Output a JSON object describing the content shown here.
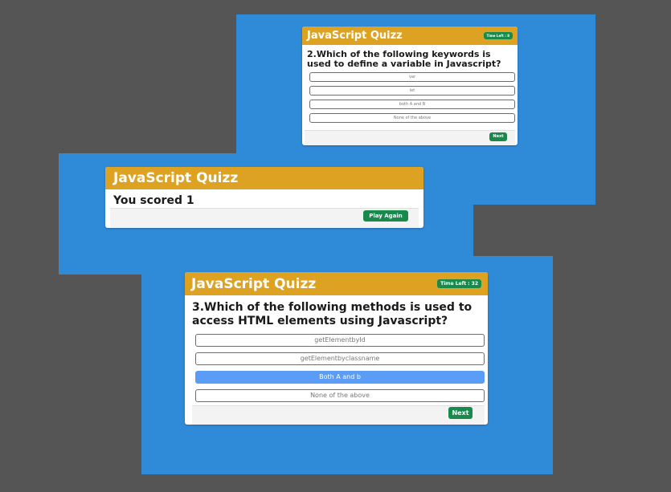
{
  "quiz_title": "JavaScript Quizz",
  "screen1": {
    "timer": "Time Left : 8",
    "question": "2.Which of the following keywords is used to define a variable in Javascript?",
    "options": [
      "var",
      "let",
      "both A and B",
      "None of the above"
    ],
    "next_label": "Next"
  },
  "screen2": {
    "result": "You scored 1",
    "play_again_label": "Play Again"
  },
  "screen3": {
    "timer": "Time Left : 32",
    "question": "3.Which of the following methods is used to access HTML elements using Javascript?",
    "options": [
      "getElementbyId",
      "getElementbyclassname",
      "Both A and b",
      "None of the above"
    ],
    "selected_option": "Both A and b",
    "next_label": "Next"
  },
  "colors": {
    "background": "#555555",
    "panel": "#2f8ad8",
    "header": "#dea223",
    "button": "#178a4c",
    "selected_option": "#5a9cf6"
  }
}
